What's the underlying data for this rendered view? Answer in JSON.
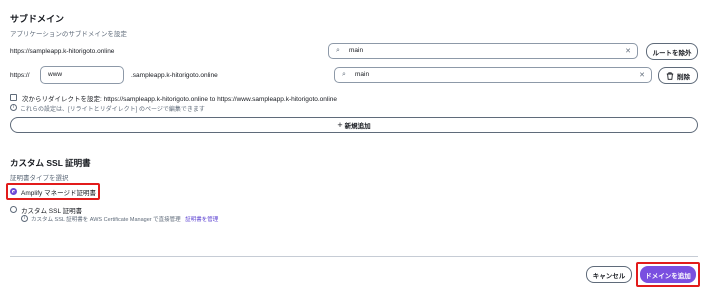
{
  "subdomain": {
    "title": "サブドメイン",
    "description": "アプリケーションのサブドメインを設定",
    "row1": {
      "url": "https://sampleapp.k-hitorigoto.online",
      "branch_value": "main",
      "remove_root_label": "ルートを除外"
    },
    "row2": {
      "prefix": "https://",
      "subdomain_value": "www",
      "suffix": ".sampleapp.k-hitorigoto.online",
      "branch_value": "main",
      "delete_label": "削除"
    },
    "redirect_checkbox_label": "次からリダイレクトを設定: https://sampleapp.k-hitorigoto.online to https://www.sampleapp.k-hitorigoto.online",
    "redirect_note": "これらの設定は、[リライトとリダイレクト] のページで編集できます",
    "add_new_label": "新規追加"
  },
  "ssl": {
    "title": "カスタム SSL 証明書",
    "description": "証明書タイプを選択",
    "options": [
      {
        "label": "Amplify マネージド証明書",
        "selected": true
      },
      {
        "label": "カスタム SSL 証明書",
        "selected": false
      }
    ],
    "custom_note": "カスタム SSL 証明書を AWS Certificate Manager で直接管理",
    "custom_note_link": "証明書を管理"
  },
  "footer": {
    "cancel_label": "キャンセル",
    "add_domain_label": "ドメインを追加"
  },
  "colors": {
    "primary": "#7a4fe0",
    "highlight": "#e21b1b",
    "link": "#5a3fd1"
  },
  "icons": {
    "search": "search-icon",
    "clear": "clear-icon",
    "trash": "trash-icon",
    "plus": "plus-icon",
    "info": "info-icon"
  }
}
